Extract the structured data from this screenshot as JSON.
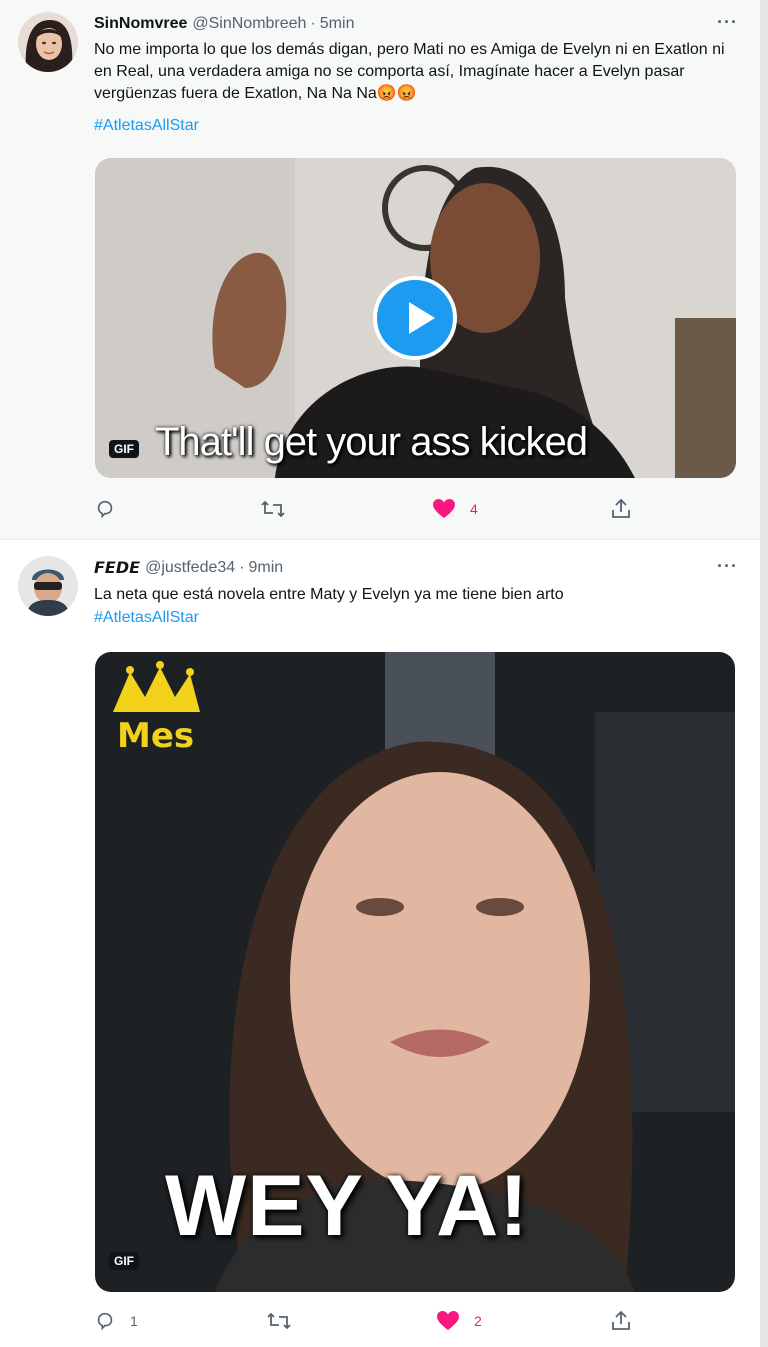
{
  "tweets": [
    {
      "author_name": "SinNomvree",
      "author_handle": "@SinNombreeh",
      "separator": "·",
      "time": "5min",
      "more": "···",
      "text": "No me importa lo que los demás digan, pero Mati no es Amiga de Evelyn ni en Exatlon ni en Real, una verdadera amiga no se comporta así, Imagínate hacer a Evelyn pasar vergüenzas fuera de Exatlon, Na Na Na😡😡",
      "hashtag": "#AtletasAllStar",
      "media": {
        "badge": "GIF",
        "caption": "That'll get your ass kicked"
      },
      "actions": {
        "reply_count": "",
        "retweet_count": "",
        "like_count": "4",
        "liked": true
      }
    },
    {
      "author_name": "𝙁𝙀𝘿𝙀",
      "author_handle": "@justfede34",
      "separator": "·",
      "time": "9min",
      "more": "···",
      "text": "La neta que está novela entre Maty y Evelyn ya me tiene bien arto",
      "hashtag": "#AtletasAllStar",
      "media": {
        "badge": "GIF",
        "caption": "WEY YA!",
        "logo_text": "Mes"
      },
      "actions": {
        "reply_count": "1",
        "retweet_count": "",
        "like_count": "2",
        "liked": true
      }
    }
  ],
  "colors": {
    "accent": "#1d9bf0",
    "like": "#f91880",
    "muted": "#536471"
  },
  "icons": [
    "reply-icon",
    "retweet-icon",
    "heart-icon",
    "share-icon",
    "play-icon",
    "more-icon"
  ]
}
